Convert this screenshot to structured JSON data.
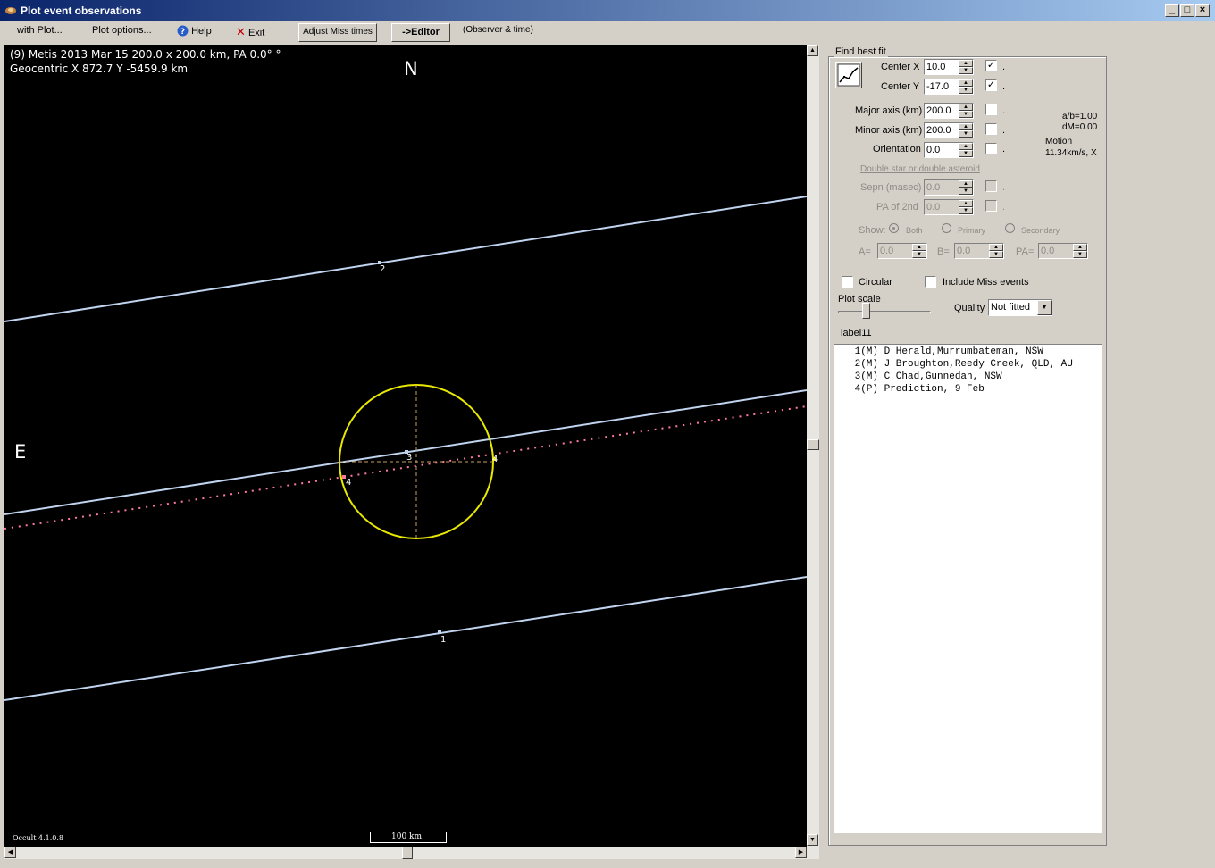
{
  "window": {
    "title": "Plot event observations"
  },
  "toolbar": {
    "with_plot": "with Plot...",
    "plot_options": "Plot options...",
    "help": "Help",
    "exit": "Exit",
    "adjust_miss": "Adjust Miss times",
    "editor": "->Editor",
    "observer_time": "(Observer & time)"
  },
  "plot": {
    "header_line1": "(9) Metis  2013 Mar 15   200.0 x 200.0 km, PA 0.0° °",
    "header_line2": "Geocentric X  872.7  Y -5459.9 km",
    "north": "N",
    "east": "E",
    "version": "Occult 4.1.0.8",
    "scale_label": "100 km.",
    "chord_labels": [
      "2",
      "3",
      "4",
      "4",
      "1"
    ],
    "colors": {
      "chords": "#c0d4f0",
      "ellipse": "#e8e800",
      "prediction": "#ff7aa0"
    }
  },
  "fit": {
    "title": "Find best fit",
    "center_x_label": "Center X",
    "center_x": "10.0",
    "center_y_label": "Center Y",
    "center_y": "-17.0",
    "major_label": "Major axis (km)",
    "major": "200.0",
    "minor_label": "Minor axis (km)",
    "minor": "200.0",
    "orient_label": "Orientation",
    "orient": "0.0",
    "ab": "a/b=1.00",
    "dm": "dM=0.00",
    "motion_label": "Motion",
    "motion_value": "11.34km/s, X",
    "dot": ".",
    "double_title": "Double star  or  double asteroid",
    "sepn_label": "Sepn (masec)",
    "sepn": "0.0",
    "pa2_label": "PA of 2nd",
    "pa2": "0.0",
    "show_label": "Show:",
    "radio_both": "Both",
    "radio_primary": "Primary",
    "radio_secondary": "Secondary",
    "a_label": "A=",
    "a_val": "0.0",
    "b_label": "B=",
    "b_val": "0.0",
    "pa_label": "PA=",
    "pa_val": "0.0",
    "circular": "Circular",
    "include_miss": "Include Miss events",
    "plot_scale": "Plot scale",
    "quality_label": "Quality",
    "quality_value": "Not fitted",
    "label11": "label11"
  },
  "observers": [
    " 1(M) D Herald,Murrumbateman, NSW",
    " 2(M) J Broughton,Reedy Creek, QLD, AU",
    " 3(M) C Chad,Gunnedah, NSW",
    " 4(P) Prediction, 9 Feb"
  ]
}
